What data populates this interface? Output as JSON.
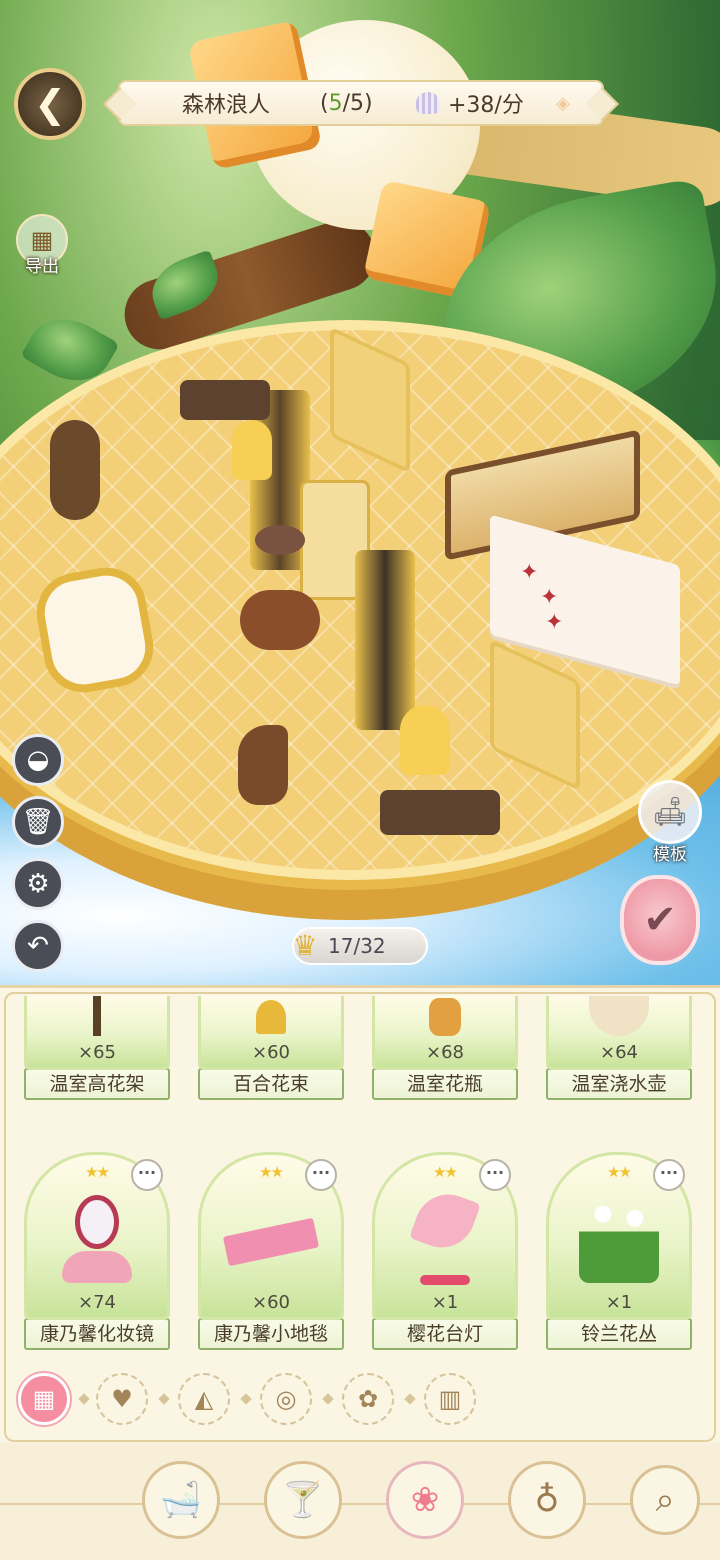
{
  "hud": {
    "back_label": "back",
    "room_name": "森林浪人",
    "progress_open": "(",
    "progress_current": "5",
    "progress_rest": "/5)",
    "income": "+38/分",
    "export_label": "导出",
    "template_label": "模板",
    "capacity": "17/32"
  },
  "items_top": [
    {
      "qty": "×65",
      "name": "温室高花架"
    },
    {
      "qty": "×60",
      "name": "百合花束"
    },
    {
      "qty": "×68",
      "name": "温室花瓶"
    },
    {
      "qty": "×64",
      "name": "温室浇水壶"
    }
  ],
  "items": [
    {
      "stars": "★★",
      "qty": "×74",
      "name": "康乃馨化妆镜"
    },
    {
      "stars": "★★",
      "qty": "×60",
      "name": "康乃馨小地毯"
    },
    {
      "stars": "★★",
      "qty": "×1",
      "name": "樱花台灯"
    },
    {
      "stars": "★★",
      "qty": "×1",
      "name": "铃兰花丛"
    }
  ],
  "more_label": "···",
  "categories": [
    "all-grid-icon",
    "watering-can-icon",
    "cake-icon",
    "plate-icon",
    "flower-icon",
    "fence-icon"
  ],
  "nav": [
    "furniture-icon",
    "cocktail-icon",
    "bouquet-icon",
    "planet-icon",
    "search-icon"
  ],
  "colors": {
    "accent": "#f58ea1",
    "progress_green": "#5e9b2e",
    "card_border": "#8fb16a"
  }
}
